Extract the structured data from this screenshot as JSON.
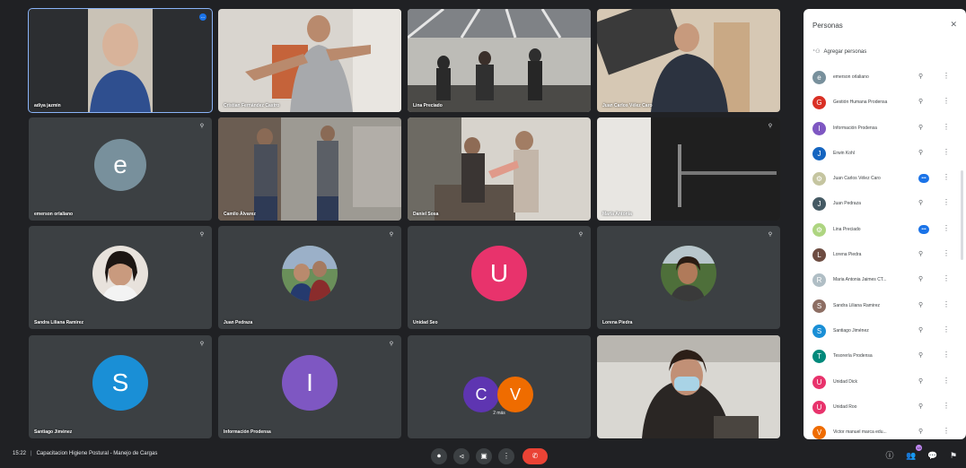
{
  "tiles": [
    {
      "name": "adiya jazmin",
      "type": "video",
      "active": true,
      "badge": "..."
    },
    {
      "name": "Cristian Fernández Castro",
      "type": "video"
    },
    {
      "name": "Lina Preciado",
      "type": "video"
    },
    {
      "name": "Juan Carlos Vélez Caro",
      "type": "video"
    },
    {
      "name": "emerson orlaliano",
      "type": "letter",
      "letter": "e",
      "color": "#78909c"
    },
    {
      "name": "Camilo Álvarez",
      "type": "video"
    },
    {
      "name": "Daniel Sosa",
      "type": "video"
    },
    {
      "name": "Maria Antonia",
      "type": "video"
    },
    {
      "name": "Sandra Liliana Ramirez",
      "type": "photo"
    },
    {
      "name": "Juan Pedraza",
      "type": "photo"
    },
    {
      "name": "Unidad Seo",
      "type": "letter",
      "letter": "U",
      "color": "#e8336c"
    },
    {
      "name": "Lorena Piedra",
      "type": "photo"
    },
    {
      "name": "Santiago Jiménez",
      "type": "letter",
      "letter": "S",
      "color": "#1a8fd6"
    },
    {
      "name": "Información Prodensa",
      "type": "letter",
      "letter": "I",
      "color": "#7e57c2"
    },
    {
      "name": "",
      "type": "dual",
      "letters": [
        "C",
        "V"
      ],
      "colors": [
        "#5e35b1",
        "#ef6c00"
      ],
      "caption": "2 más"
    },
    {
      "name": "",
      "type": "video"
    }
  ],
  "panel": {
    "title": "Personas",
    "close": "✕",
    "add": "Agregar personas",
    "people": [
      {
        "name": "emerson orlaliano",
        "letter": "e",
        "color": "#78909c"
      },
      {
        "name": "Gestión Humana Prodensa",
        "letter": "G",
        "color": "#d93025"
      },
      {
        "name": "Información Prodensa",
        "letter": "I",
        "color": "#7e57c2"
      },
      {
        "name": "Erwin Kohl",
        "letter": "J",
        "color": "#1565c0"
      },
      {
        "name": "Juan Carlos Vélez Caro",
        "letter": "⚙",
        "color": "#c5c5a0",
        "pinned": true
      },
      {
        "name": "Juan Pedraza",
        "letter": "J",
        "color": "#455a64"
      },
      {
        "name": "Lina Preciado",
        "letter": "⚙",
        "color": "#aed581",
        "pinned": true
      },
      {
        "name": "Lorena Piedra",
        "letter": "L",
        "color": "#6d4c41"
      },
      {
        "name": "Maria Antonia Jaimes CT...",
        "letter": "R",
        "color": "#b0bec5"
      },
      {
        "name": "Sandra Liliana Ramirez",
        "letter": "S",
        "color": "#8d6e63"
      },
      {
        "name": "Santiago Jiménez",
        "letter": "S",
        "color": "#1a8fd6"
      },
      {
        "name": "Tesorería Prodensa",
        "letter": "T",
        "color": "#00897b"
      },
      {
        "name": "Unidad Dick",
        "letter": "U",
        "color": "#e8336c"
      },
      {
        "name": "Unidad Roo",
        "letter": "U",
        "color": "#e8336c"
      },
      {
        "name": "Victor manuel marca edu...",
        "letter": "V",
        "color": "#ef6c00"
      }
    ]
  },
  "bar": {
    "time": "15:22",
    "title": "Capacitacion Higiene Postural - Manejo de Cargas",
    "controls": [
      "⏺",
      "⏿",
      "▣",
      "⋮"
    ],
    "end": "✆",
    "right_icons": [
      "ⓘ",
      "👥",
      "💬",
      "⚑"
    ],
    "people_count": "18"
  }
}
